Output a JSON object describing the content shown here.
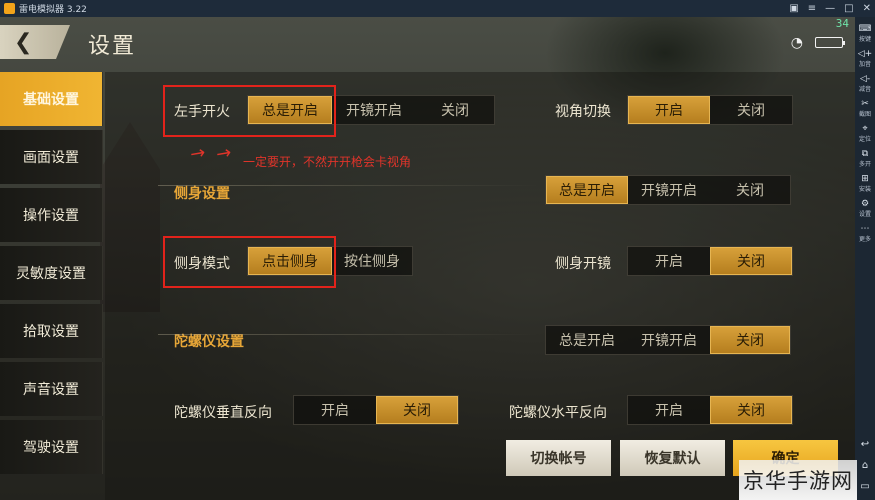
{
  "titlebar": {
    "title": "雷电模拟器 3.22",
    "controls": [
      "gift-icon",
      "menu-icon",
      "minimize-icon",
      "maximize-icon",
      "close-icon"
    ]
  },
  "status": {
    "time": "34",
    "icons": [
      "wifi-icon",
      "battery-icon"
    ]
  },
  "header": {
    "back_icon": "chevron-left-icon",
    "title": "设置"
  },
  "side_menu": [
    {
      "label": "基础设置",
      "active": true
    },
    {
      "label": "画面设置",
      "active": false
    },
    {
      "label": "操作设置",
      "active": false
    },
    {
      "label": "灵敏度设置",
      "active": false
    },
    {
      "label": "拾取设置",
      "active": false
    },
    {
      "label": "声音设置",
      "active": false
    },
    {
      "label": "驾驶设置",
      "active": false
    }
  ],
  "settings": {
    "left_fire": {
      "label": "左手开火",
      "options": [
        "总是开启",
        "开镜开启",
        "关闭"
      ],
      "selected": 0
    },
    "view_switch": {
      "label": "视角切换",
      "options": [
        "开启",
        "关闭"
      ],
      "selected": 0
    },
    "lean_section": {
      "title": "侧身设置",
      "options": [
        "总是开启",
        "开镜开启",
        "关闭"
      ],
      "selected": 0
    },
    "lean_mode": {
      "label": "侧身模式",
      "options": [
        "点击侧身",
        "按住侧身"
      ],
      "selected": 0
    },
    "lean_scope": {
      "label": "侧身开镜",
      "options": [
        "开启",
        "关闭"
      ],
      "selected": 1
    },
    "gyro_section": {
      "title": "陀螺仪设置",
      "options": [
        "总是开启",
        "开镜开启",
        "关闭"
      ],
      "selected": 2
    },
    "gyro_vertical": {
      "label": "陀螺仪垂直反向",
      "options": [
        "开启",
        "关闭"
      ],
      "selected": 1
    },
    "gyro_horizontal": {
      "label": "陀螺仪水平反向",
      "options": [
        "开启",
        "关闭"
      ],
      "selected": 1
    }
  },
  "annotation": {
    "note": "一定要开，不然开开枪会卡视角"
  },
  "buttons": {
    "switch_account": "切换帐号",
    "restore_default": "恢复默认",
    "confirm": "确定"
  },
  "toolbar": [
    {
      "icon": "keyboard-icon",
      "label": "按键"
    },
    {
      "icon": "volume-up-icon",
      "label": "加音"
    },
    {
      "icon": "volume-down-icon",
      "label": "减音"
    },
    {
      "icon": "scissors-icon",
      "label": "截图"
    },
    {
      "icon": "location-icon",
      "label": "定位"
    },
    {
      "icon": "multi-window-icon",
      "label": "多开"
    },
    {
      "icon": "install-icon",
      "label": "安装"
    },
    {
      "icon": "gear-icon",
      "label": "设置"
    },
    {
      "icon": "more-icon",
      "label": "更多"
    }
  ],
  "bottom_nav_icons": [
    "back-icon",
    "home-icon",
    "recent-apps-icon"
  ],
  "watermark": "京华手游网",
  "colors": {
    "accent": "#e6a424",
    "annotation_red": "#e2231b"
  }
}
